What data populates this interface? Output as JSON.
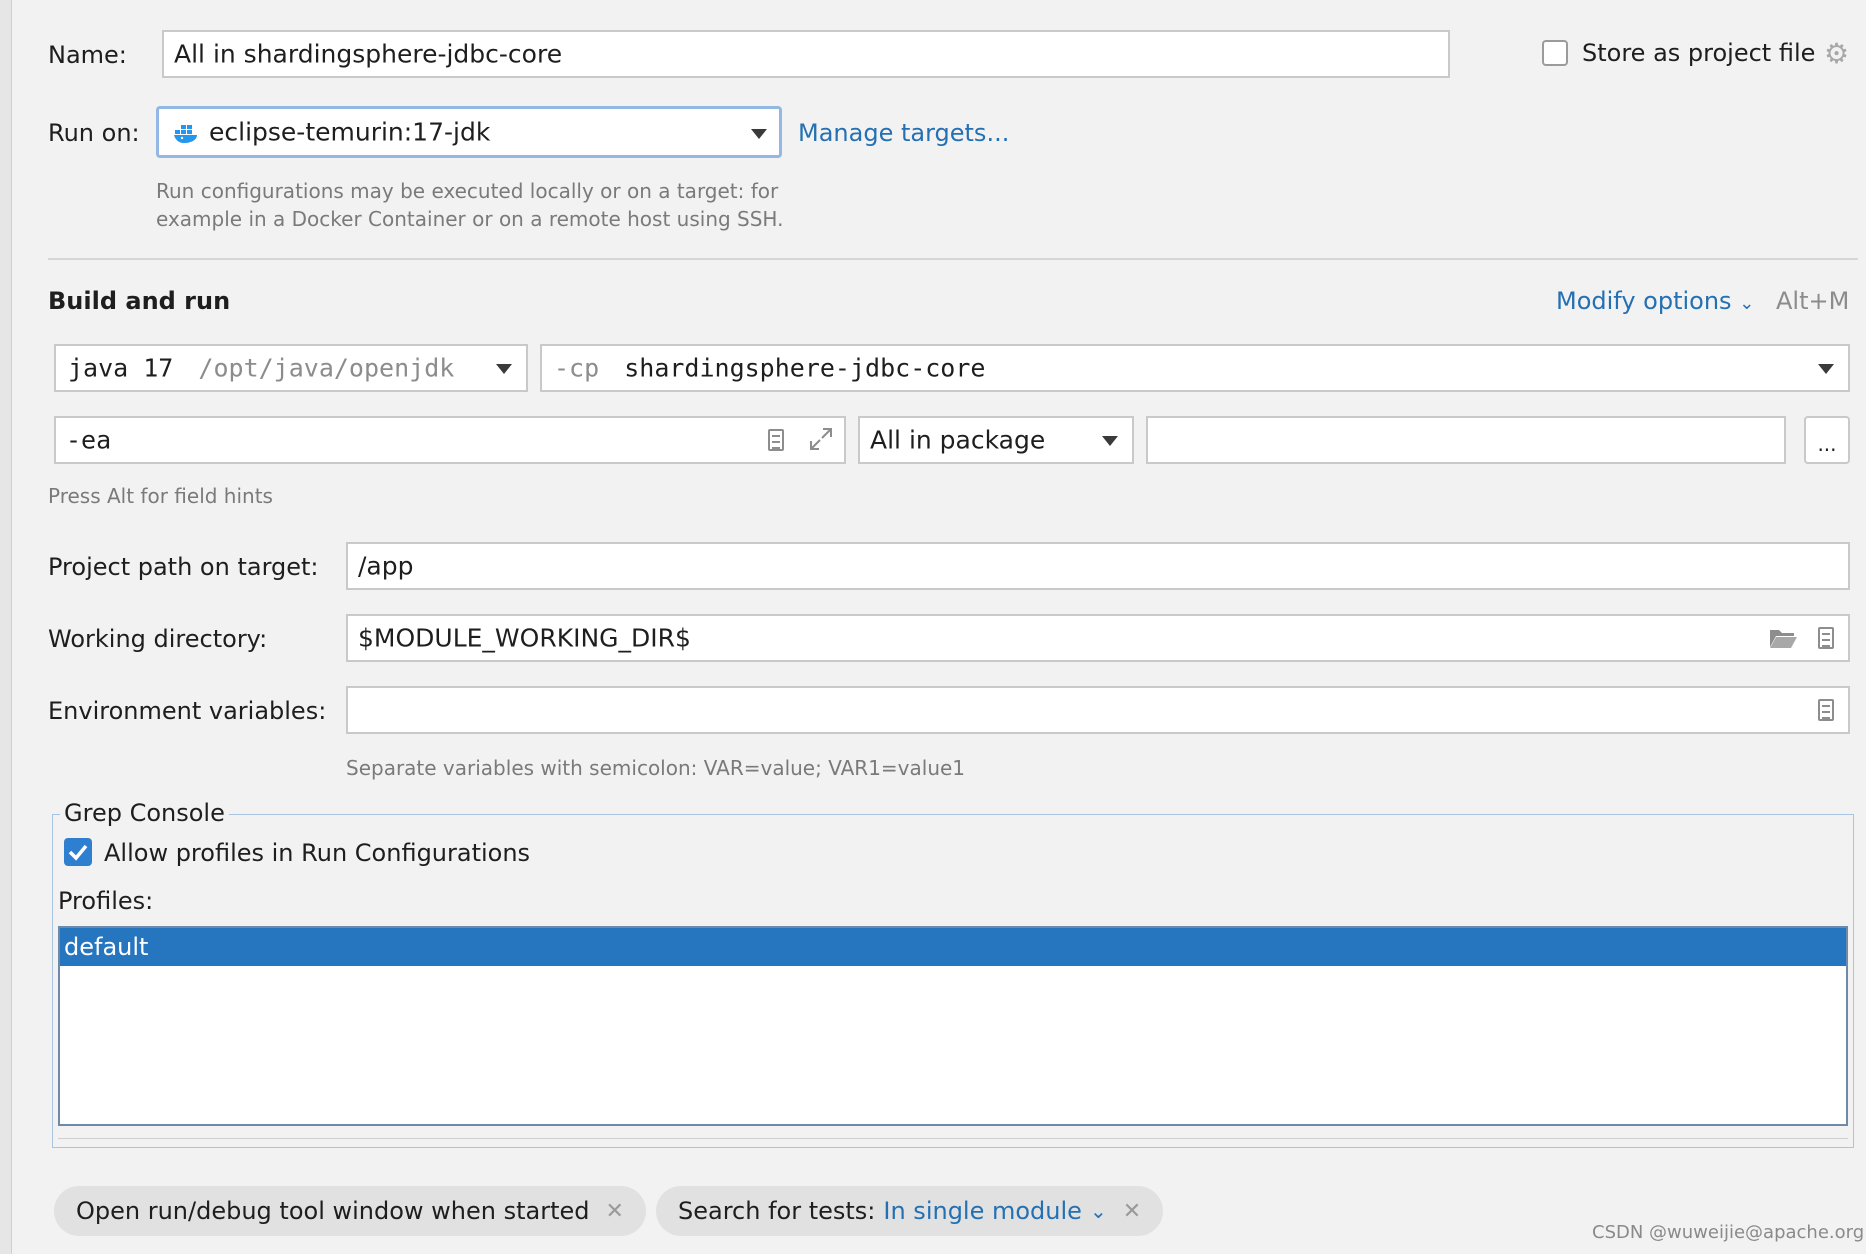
{
  "name": {
    "label": "Name:",
    "value": "All in shardingsphere-jdbc-core"
  },
  "store_project": {
    "label": "Store as project file",
    "checked": false
  },
  "run_on": {
    "label": "Run on:",
    "value": "eclipse-temurin:17-jdk",
    "manage_link": "Manage targets...",
    "hint_line1": "Run configurations may be executed locally or on a target: for",
    "hint_line2": "example in a Docker Container or on a remote host using SSH."
  },
  "build": {
    "title": "Build and run",
    "modify_options": "Modify options",
    "shortcut": "Alt+M",
    "jdk_name": "java 17",
    "jdk_path": "/opt/java/openjdk",
    "cp_prefix": "-cp",
    "cp_value": "shardingsphere-jdbc-core",
    "vm_options": "-ea",
    "test_kind": "All in package",
    "package_value": "",
    "browse_label": "...",
    "field_hint": "Press Alt for field hints"
  },
  "project_path": {
    "label": "Project path on target:",
    "value": "/app"
  },
  "working_dir": {
    "label": "Working directory:",
    "value": "$MODULE_WORKING_DIR$"
  },
  "env_vars": {
    "label": "Environment variables:",
    "value": "",
    "hint": "Separate variables with semicolon: VAR=value; VAR1=value1"
  },
  "grep_console": {
    "title": "Grep Console",
    "allow_label": "Allow profiles in Run Configurations",
    "allow_checked": true,
    "profiles_label": "Profiles:",
    "profiles": [
      "default"
    ]
  },
  "chips": {
    "open_tool_window": "Open run/debug tool window when started",
    "search_label": "Search for tests:",
    "search_value": "In single module"
  },
  "watermark": "CSDN @wuweijie@apache.org",
  "colors": {
    "accent": "#2470b3",
    "selection": "#2675bf",
    "background": "#f2f2f2"
  }
}
